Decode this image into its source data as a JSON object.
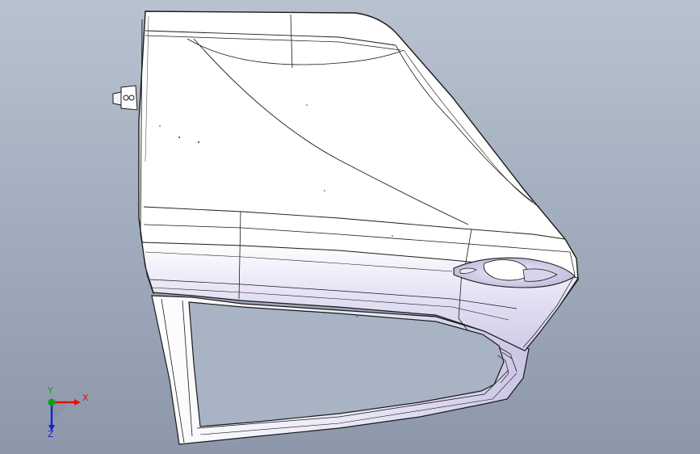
{
  "viewport": {
    "background_top": "#b9c2cf",
    "background_bottom": "#8c98aa",
    "model": {
      "body_color": "#ffffff",
      "shade_color": "#d9d6ef",
      "edge_color": "#1a1a1a"
    }
  },
  "triad": {
    "x_label": "X",
    "y_label": "Y",
    "z_label": "Z",
    "x_color": "#e01010",
    "y_color": "#10a010",
    "z_color": "#2020d0"
  }
}
